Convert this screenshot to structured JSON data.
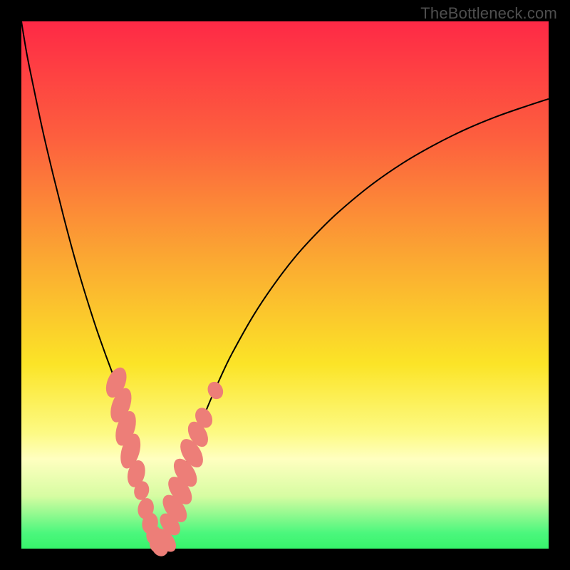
{
  "watermark": "TheBottleneck.com",
  "colors": {
    "frame": "#000000",
    "curve_stroke": "#000000",
    "marker_fill": "#ed7e78",
    "gradient_stops": [
      {
        "pct": 0,
        "color": "#fe2946"
      },
      {
        "pct": 22,
        "color": "#fd5f3e"
      },
      {
        "pct": 45,
        "color": "#fba832"
      },
      {
        "pct": 65,
        "color": "#fbe427"
      },
      {
        "pct": 78,
        "color": "#fdfa83"
      },
      {
        "pct": 83,
        "color": "#ffffc0"
      },
      {
        "pct": 90,
        "color": "#d7fca2"
      },
      {
        "pct": 97,
        "color": "#4cf77d"
      },
      {
        "pct": 100,
        "color": "#37f36b"
      }
    ]
  },
  "chart_data": {
    "type": "line",
    "title": "",
    "xlabel": "",
    "ylabel": "",
    "xlim": [
      0,
      100
    ],
    "ylim": [
      0,
      100
    ],
    "grid": false,
    "legend": false,
    "x": [
      0,
      1,
      2,
      4,
      6,
      8,
      10,
      12,
      14,
      15,
      16,
      17,
      18,
      19,
      19.5,
      20,
      20.5,
      21,
      21.5,
      22,
      22.5,
      23,
      23.5,
      24,
      24.5,
      25,
      25.5,
      26,
      27,
      28,
      29,
      30,
      32,
      34,
      36,
      38,
      40,
      44,
      48,
      52,
      56,
      60,
      66,
      72,
      78,
      84,
      90,
      96,
      100
    ],
    "values": [
      100,
      94,
      89,
      79.5,
      71,
      63,
      55.5,
      48.7,
      42.4,
      39.5,
      36.7,
      34,
      31.4,
      28.9,
      26.5,
      24.1,
      21.8,
      19.5,
      17.3,
      15.1,
      13,
      10.9,
      8.9,
      6.9,
      5.0,
      3.2,
      1.4,
      0,
      1.8,
      5.5,
      9.0,
      12.3,
      18.2,
      23.6,
      28.5,
      33.0,
      37.1,
      44.2,
      50.2,
      55.4,
      59.8,
      63.7,
      68.7,
      72.9,
      76.4,
      79.4,
      81.9,
      84.0,
      85.3
    ],
    "markers": [
      {
        "x": 18.0,
        "y": 31.5,
        "rx": 1.7,
        "ry": 3.0,
        "rot": 22
      },
      {
        "x": 18.9,
        "y": 27.2,
        "rx": 1.7,
        "ry": 3.4,
        "rot": 20
      },
      {
        "x": 19.8,
        "y": 22.8,
        "rx": 1.7,
        "ry": 3.4,
        "rot": 18
      },
      {
        "x": 20.7,
        "y": 18.5,
        "rx": 1.7,
        "ry": 3.4,
        "rot": 16
      },
      {
        "x": 21.8,
        "y": 14.2,
        "rx": 1.6,
        "ry": 2.6,
        "rot": 14
      },
      {
        "x": 22.8,
        "y": 11.0,
        "rx": 1.4,
        "ry": 1.8,
        "rot": 14
      },
      {
        "x": 23.6,
        "y": 7.6,
        "rx": 1.5,
        "ry": 2.0,
        "rot": 12
      },
      {
        "x": 24.4,
        "y": 4.8,
        "rx": 1.5,
        "ry": 2.0,
        "rot": 10
      },
      {
        "x": 25.1,
        "y": 2.6,
        "rx": 1.4,
        "ry": 1.8,
        "rot": 6
      },
      {
        "x": 25.7,
        "y": 1.0,
        "rx": 1.4,
        "ry": 1.7,
        "rot": 2
      },
      {
        "x": 26.3,
        "y": 0.3,
        "rx": 1.5,
        "ry": 1.8,
        "rot": -25
      },
      {
        "x": 27.3,
        "y": 1.6,
        "rx": 1.5,
        "ry": 2.6,
        "rot": -40
      },
      {
        "x": 28.2,
        "y": 4.6,
        "rx": 1.5,
        "ry": 2.4,
        "rot": -40
      },
      {
        "x": 29.1,
        "y": 7.6,
        "rx": 1.7,
        "ry": 3.0,
        "rot": -38
      },
      {
        "x": 30.1,
        "y": 11.0,
        "rx": 1.7,
        "ry": 3.0,
        "rot": -36
      },
      {
        "x": 31.1,
        "y": 14.4,
        "rx": 1.7,
        "ry": 3.0,
        "rot": -34
      },
      {
        "x": 32.3,
        "y": 18.1,
        "rx": 1.7,
        "ry": 3.0,
        "rot": -32
      },
      {
        "x": 33.5,
        "y": 21.7,
        "rx": 1.6,
        "ry": 2.6,
        "rot": -30
      },
      {
        "x": 34.6,
        "y": 24.8,
        "rx": 1.5,
        "ry": 2.0,
        "rot": -28
      },
      {
        "x": 36.8,
        "y": 30.0,
        "rx": 1.4,
        "ry": 1.7,
        "rot": -26
      }
    ]
  }
}
